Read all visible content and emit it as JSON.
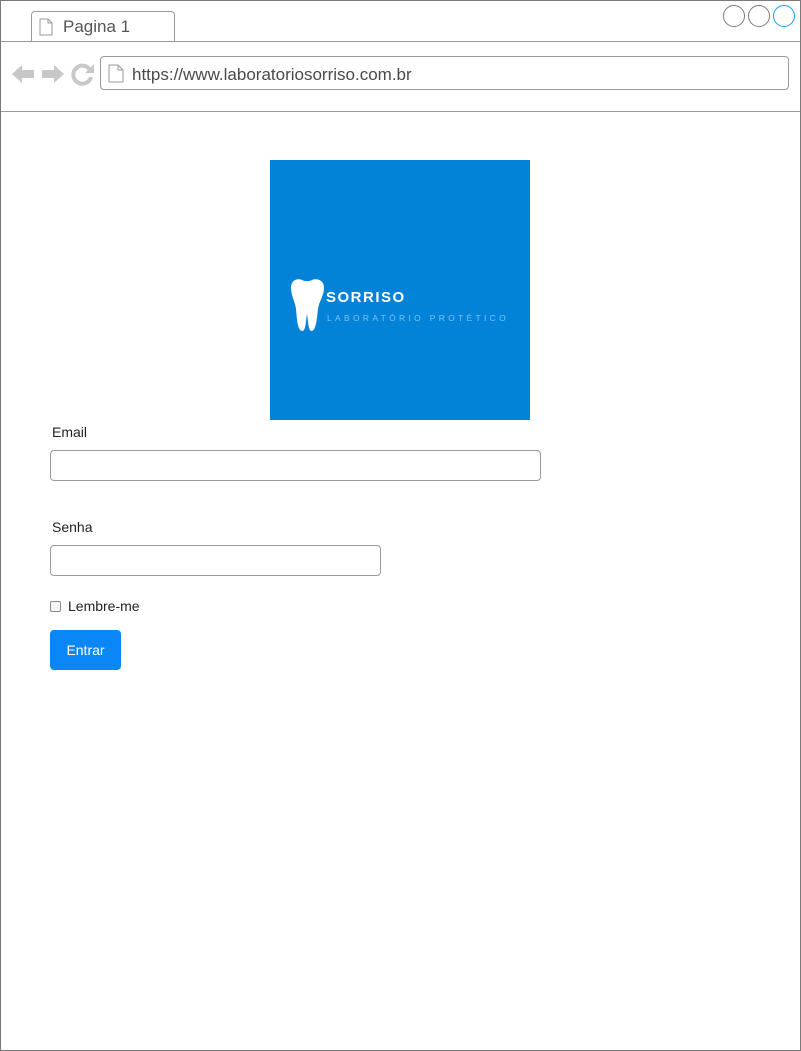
{
  "browser": {
    "tab": {
      "label": "Pagina 1",
      "icon": "page-icon"
    },
    "window_controls": [
      "circle",
      "circle",
      "circle"
    ],
    "nav": {
      "back_icon": "arrow-left-icon",
      "forward_icon": "arrow-right-icon",
      "reload_icon": "reload-icon"
    },
    "address": {
      "icon": "page-icon",
      "url": "https://www.laboratoriosorriso.com.br"
    }
  },
  "logo": {
    "icon": "tooth-icon",
    "title": "SORRISO",
    "subtitle": "LABORATÓRIO PROTÉTICO",
    "background_color": "#0283d8"
  },
  "form": {
    "email_label": "Email",
    "email_value": "",
    "senha_label": "Senha",
    "senha_value": "",
    "remember_label": "Lembre-me",
    "remember_checked": false,
    "submit_label": "Entrar",
    "submit_color": "#0b87f5"
  }
}
